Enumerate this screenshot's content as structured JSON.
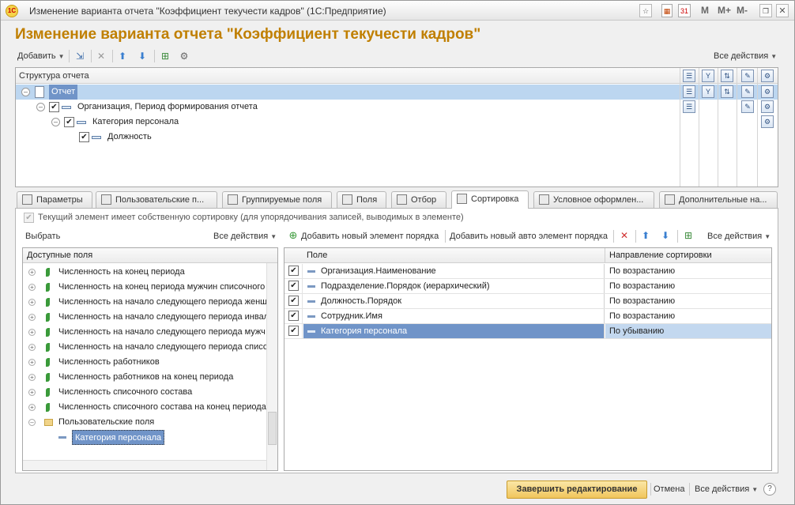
{
  "window": {
    "title": "Изменение варианта отчета \"Коэффициент текучести кадров\"  (1С:Предприятие)",
    "logo_text": "1С",
    "m_label": "M",
    "mplus_label": "M+",
    "mminus_label": "M-",
    "calendar_day": "31"
  },
  "page_title": "Изменение варианта отчета \"Коэффициент текучести кадров\"",
  "main_toolbar": {
    "add_label": "Добавить",
    "all_actions_label": "Все действия"
  },
  "structure": {
    "header": "Структура отчета",
    "nodes": [
      {
        "label": "Отчет",
        "level": 0,
        "selected": true
      },
      {
        "label": "Организация, Период формирования отчета",
        "level": 1,
        "checked": true
      },
      {
        "label": "Категория персонала",
        "level": 2,
        "checked": true
      },
      {
        "label": "Должность",
        "level": 3,
        "checked": true
      }
    ]
  },
  "tabs": [
    {
      "label": "Параметры"
    },
    {
      "label": "Пользовательские п..."
    },
    {
      "label": "Группируемые поля"
    },
    {
      "label": "Поля"
    },
    {
      "label": "Отбор"
    },
    {
      "label": "Сортировка",
      "active": true
    },
    {
      "label": "Условное оформлен..."
    },
    {
      "label": "Дополнительные на..."
    }
  ],
  "sorting": {
    "own_sort_note": "Текущий элемент имеет собственную сортировку (для  упорядочивания записей, выводимых в элементе)",
    "select_label": "Выбрать",
    "left_all_actions": "Все действия",
    "add_item_label": "Добавить новый элемент порядка",
    "add_auto_label": "Добавить новый авто элемент порядка",
    "right_all_actions": "Все действия",
    "available_header": "Доступные поля",
    "available_fields": [
      "Численность на конец периода",
      "Численность на конец периода мужчин списочного",
      "Численность на начало следующего периода женщ",
      "Численность на начало следующего периода инвал",
      "Численность на начало следующего периода мужч",
      "Численность на начало следующего периода списо",
      "Численность работников",
      "Численность работников на конец периода",
      "Численность списочного состава",
      "Численность списочного состава на конец периода"
    ],
    "user_fields_folder": "Пользовательские поля",
    "user_field_selected": "Категория персонала",
    "table_headers": {
      "field": "Поле",
      "direction": "Направление сортировки"
    },
    "rows": [
      {
        "field": "Организация.Наименование",
        "direction": "По возрастанию",
        "checked": true
      },
      {
        "field": "Подразделение.Порядок (иерархический)",
        "direction": "По возрастанию",
        "checked": true
      },
      {
        "field": "Должность.Порядок",
        "direction": "По возрастанию",
        "checked": true
      },
      {
        "field": "Сотрудник.Имя",
        "direction": "По возрастанию",
        "checked": true
      },
      {
        "field": "Категория персонала",
        "direction": "По убыванию",
        "checked": true,
        "selected": true
      }
    ]
  },
  "footer": {
    "finish_label": "Завершить редактирование",
    "cancel_label": "Отмена",
    "all_actions_label": "Все действия",
    "help_label": "?"
  },
  "colors": {
    "title_accent": "#c07f00",
    "selection": "#bcd6f0",
    "row_selection": "#7094c8",
    "finish_button": "#f0c55c"
  }
}
